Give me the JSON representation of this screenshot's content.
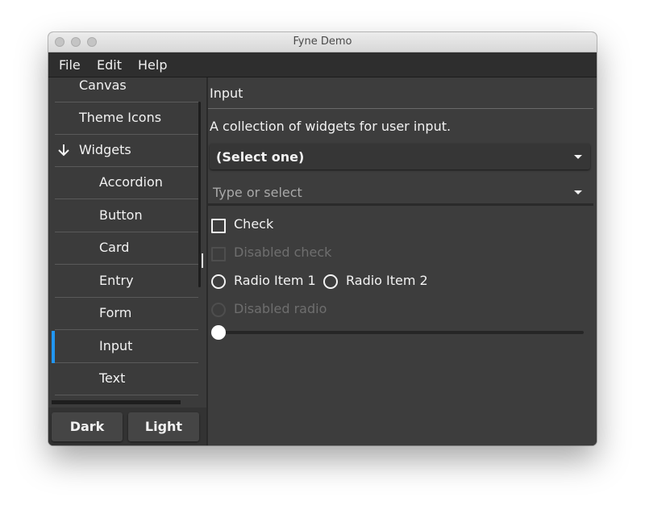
{
  "window": {
    "title": "Fyne Demo"
  },
  "menu": [
    "File",
    "Edit",
    "Help"
  ],
  "nav": {
    "items": [
      {
        "label": "Canvas",
        "indent": 0
      },
      {
        "label": "Theme Icons",
        "indent": 0
      },
      {
        "label": "Widgets",
        "indent": 0,
        "expanded": true
      },
      {
        "label": "Accordion",
        "indent": 1
      },
      {
        "label": "Button",
        "indent": 1
      },
      {
        "label": "Card",
        "indent": 1
      },
      {
        "label": "Entry",
        "indent": 1
      },
      {
        "label": "Form",
        "indent": 1
      },
      {
        "label": "Input",
        "indent": 1,
        "selected": true
      },
      {
        "label": "Text",
        "indent": 1
      }
    ],
    "selected_color": "#2196f3",
    "dark_label": "Dark",
    "light_label": "Light"
  },
  "panel": {
    "title": "Input",
    "description": "A collection of widgets for user input.",
    "select_value": "(Select one)",
    "select_entry_placeholder": "Type or select",
    "check_label": "Check",
    "disabled_check_label": "Disabled check",
    "radio_items": [
      "Radio Item 1",
      "Radio Item 2"
    ],
    "disabled_radio_label": "Disabled radio",
    "slider_value": 0
  }
}
